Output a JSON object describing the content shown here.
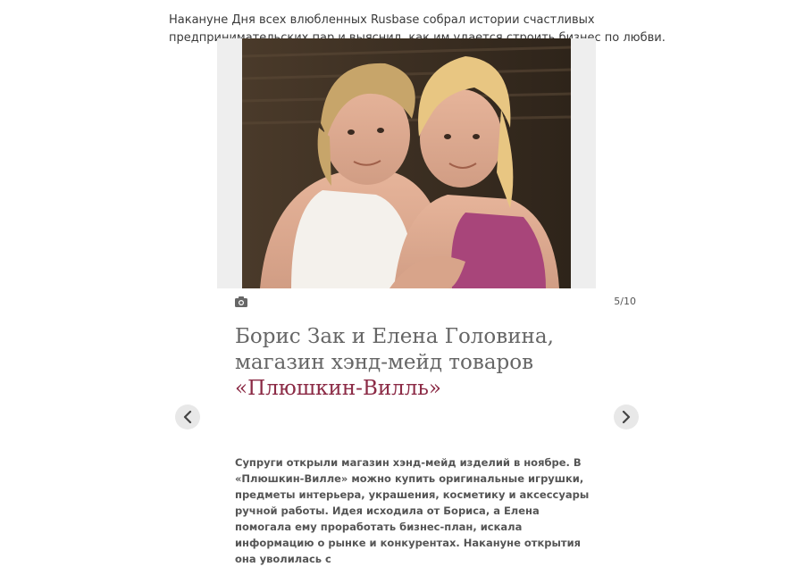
{
  "intro": {
    "text": "Накануне Дня всех влюбленных Rusbase собрал истории счастливых предпринимательских пар и выяснил, как им удается строить бизнес по любви."
  },
  "slide": {
    "photo_alt": "Борис Зак и Елена Головина",
    "counter": "5/10",
    "title_prefix": "Борис Зак и Елена Головина, магазин хэнд-мейд товаров ",
    "title_brand": "«Плюшкин-Вилль»",
    "description": "Супруги открыли магазин хэнд-мейд изделий в ноябре. В «Плюшкин-Вилле» можно купить оригинальные игрушки, предметы интерьера, украшения, косметику и аксессуары ручной работы. Идея исходила от Бориса, а Елена помогала ему проработать бизнес-план, искала информацию о рынке и конкурентах. Накануне открытия она уволилась с"
  },
  "icons": {
    "camera": "camera-icon",
    "prev": "chevron-left-icon",
    "next": "chevron-right-icon"
  },
  "colors": {
    "brand": "#8b2a45",
    "title": "#666666",
    "nav_bg": "#e8e8e8"
  }
}
